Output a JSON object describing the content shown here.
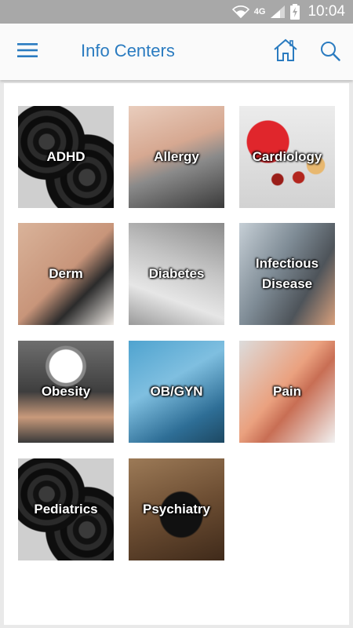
{
  "status_bar": {
    "network": "4G",
    "time": "10:04",
    "icons": [
      "wifi-icon",
      "signal-icon",
      "battery-charging-icon"
    ]
  },
  "app_bar": {
    "title": "Info Centers",
    "icons": [
      "menu-icon",
      "home-icon",
      "search-icon"
    ],
    "accent_color": "#2a7bc0"
  },
  "tiles": [
    {
      "label": "ADHD"
    },
    {
      "label": "Allergy"
    },
    {
      "label": "Cardiology"
    },
    {
      "label": "Derm"
    },
    {
      "label": "Diabetes"
    },
    {
      "label": "Infectious\nDisease"
    },
    {
      "label": "Obesity"
    },
    {
      "label": "OB/GYN"
    },
    {
      "label": "Pain"
    },
    {
      "label": "Pediatrics"
    },
    {
      "label": "Psychiatry"
    }
  ]
}
